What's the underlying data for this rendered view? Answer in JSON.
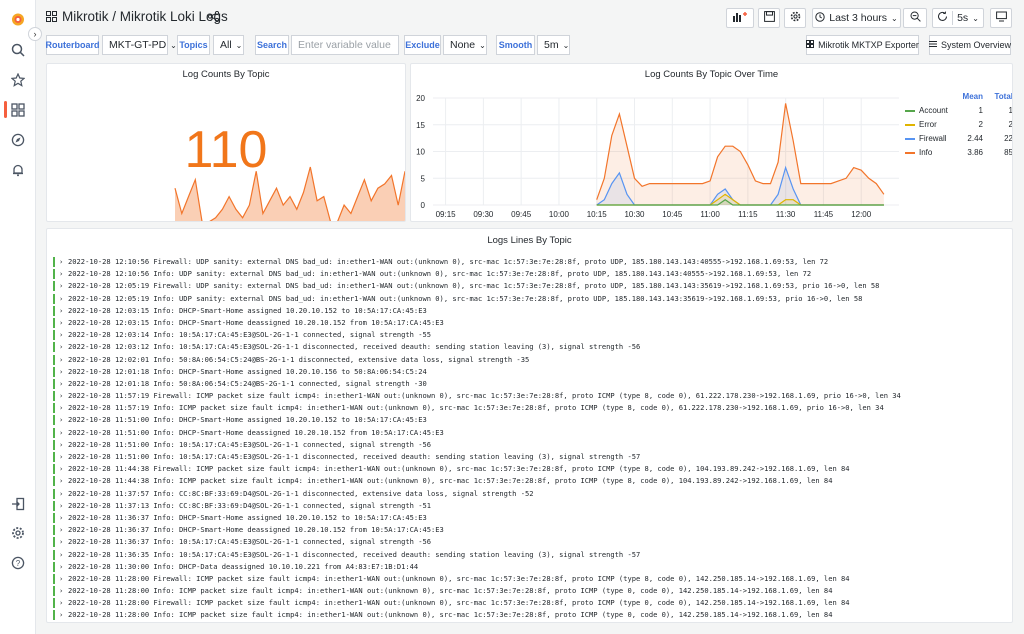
{
  "topbar": {
    "title": "Mikrotik / Mikrotik Loki Logs",
    "time_range": "Last 3 hours",
    "refresh": "5s"
  },
  "variables": {
    "routerboard_label": "Routerboard",
    "routerboard_value": "MKT-GT-PD",
    "topics_label": "Topics",
    "topics_value": "All",
    "search_label": "Search",
    "search_placeholder": "Enter variable value",
    "exclude_label": "Exclude",
    "exclude_value": "None",
    "smooth_label": "Smooth",
    "smooth_value": "5m",
    "link1": "Mikrotik MKTXP Exporter",
    "link2": "System Overview"
  },
  "panels": {
    "stat_title": "Log Counts By Topic",
    "stat_value": "110",
    "timeseries_title": "Log Counts By Topic Over Time",
    "logs_title": "Logs Lines By Topic"
  },
  "legend": {
    "mean_header": "Mean",
    "total_header": "Total",
    "items": [
      {
        "name": "Account",
        "mean": "1",
        "total": "1",
        "color": "#56a64b"
      },
      {
        "name": "Error",
        "mean": "2",
        "total": "2",
        "color": "#e0b400"
      },
      {
        "name": "Firewall",
        "mean": "2.44",
        "total": "22",
        "color": "#5794f2"
      },
      {
        "name": "Info",
        "mean": "3.86",
        "total": "85",
        "color": "#f2752b"
      }
    ]
  },
  "chart_data": {
    "type": "area",
    "x": [
      "09:15",
      "09:30",
      "09:45",
      "10:00",
      "10:15",
      "10:30",
      "10:45",
      "11:00",
      "11:15",
      "11:30",
      "11:45",
      "12:00"
    ],
    "ylim": [
      0,
      20
    ],
    "yticks": [
      "0",
      "5",
      "10",
      "15",
      "20"
    ],
    "grid": true,
    "legend_position": "top-right",
    "sample_times": [
      "10:15",
      "10:18",
      "10:21",
      "10:24",
      "10:27",
      "10:30",
      "10:33",
      "10:36",
      "10:39",
      "10:42",
      "10:45",
      "10:48",
      "10:51",
      "10:54",
      "10:57",
      "11:00",
      "11:03",
      "11:06",
      "11:09",
      "11:12",
      "11:15",
      "11:18",
      "11:21",
      "11:24",
      "11:27",
      "11:30",
      "11:33",
      "11:36",
      "11:39",
      "11:42",
      "11:45",
      "11:48",
      "11:51",
      "11:54",
      "11:57",
      "12:00",
      "12:03",
      "12:06",
      "12:09"
    ],
    "series": [
      {
        "name": "Info",
        "color": "#f2752b",
        "values": [
          1,
          5,
          13,
          17,
          11,
          5,
          3.5,
          4,
          4,
          4,
          4,
          4,
          4,
          4,
          4,
          4.5,
          9,
          11,
          11,
          10,
          7.5,
          4.5,
          4,
          4,
          8,
          19,
          12,
          4,
          4,
          4,
          4,
          4,
          4.5,
          5,
          7,
          6.5,
          5,
          4,
          2
        ]
      },
      {
        "name": "Firewall",
        "color": "#5794f2",
        "values": [
          0,
          1,
          4,
          6,
          2,
          0,
          0,
          0,
          0,
          0,
          0,
          0,
          0,
          0,
          0,
          0,
          2,
          3,
          1,
          0,
          0,
          0,
          0,
          0,
          2,
          7,
          3,
          0,
          0,
          0,
          0,
          0,
          0,
          0,
          0,
          0,
          0,
          0,
          0
        ]
      },
      {
        "name": "Error",
        "color": "#e0b400",
        "values": [
          0,
          0,
          0,
          0,
          0,
          0,
          0,
          0,
          0,
          0,
          0,
          0,
          0,
          0,
          0,
          0,
          1,
          2,
          1,
          0,
          0,
          0,
          0,
          0,
          0,
          1,
          1,
          0,
          0,
          0,
          0,
          0,
          0,
          0,
          0,
          0,
          0,
          0,
          0
        ]
      },
      {
        "name": "Account",
        "color": "#56a64b",
        "values": [
          0,
          0,
          0,
          0,
          0,
          0,
          0,
          0,
          0,
          0,
          0,
          0,
          0,
          0,
          0,
          0,
          0,
          1,
          0,
          0,
          0,
          0,
          0,
          0,
          0,
          0,
          0,
          0,
          0,
          0,
          0,
          0,
          0,
          0,
          0,
          0,
          0,
          0,
          0
        ]
      }
    ]
  },
  "sparkline": {
    "color": "#f2752b",
    "values": [
      8,
      2,
      6,
      10,
      0,
      0,
      1,
      3,
      6,
      3,
      1,
      4,
      12,
      2,
      5,
      8,
      4,
      6,
      3,
      7,
      13,
      5,
      6,
      0,
      0,
      4,
      2,
      6,
      10,
      5,
      8,
      9,
      11,
      4,
      12
    ]
  },
  "logs": [
    "2022-10-28 12:10:56 Firewall: UDP sanity: external DNS bad_ud: in:ether1-WAN out:(unknown 0), src-mac 1c:57:3e:7e:28:8f, proto UDP, 185.180.143.143:40555->192.168.1.69:53, len 72",
    "2022-10-28 12:10:56 Info: UDP sanity: external DNS bad_ud: in:ether1-WAN out:(unknown 0), src-mac 1c:57:3e:7e:28:8f, proto UDP, 185.180.143.143:40555->192.168.1.69:53, len 72",
    "2022-10-28 12:05:19 Firewall: UDP sanity: external DNS bad_ud: in:ether1-WAN out:(unknown 0), src-mac 1c:57:3e:7e:28:8f, proto UDP, 185.180.143.143:35619->192.168.1.69:53, prio 16->0, len 58",
    "2022-10-28 12:05:19 Info: UDP sanity: external DNS bad_ud: in:ether1-WAN out:(unknown 0), src-mac 1c:57:3e:7e:28:8f, proto UDP, 185.180.143.143:35619->192.168.1.69:53, prio 16->0, len 58",
    "2022-10-28 12:03:15 Info: DHCP-Smart-Home assigned 10.20.10.152 to 10:5A:17:CA:45:E3",
    "2022-10-28 12:03:15 Info: DHCP-Smart-Home deassigned 10.20.10.152 from 10:5A:17:CA:45:E3",
    "2022-10-28 12:03:14 Info: 10:5A:17:CA:45:E3@SOL-2G-1-1 connected, signal strength -55",
    "2022-10-28 12:03:12 Info: 10:5A:17:CA:45:E3@SOL-2G-1-1 disconnected, received deauth: sending station leaving (3), signal strength -56",
    "2022-10-28 12:02:01 Info: 50:8A:06:54:C5:24@BS-2G-1-1 disconnected, extensive data loss, signal strength -35",
    "2022-10-28 12:01:18 Info: DHCP-Smart-Home assigned 10.20.10.156 to 50:8A:06:54:C5:24",
    "2022-10-28 12:01:18 Info: 50:8A:06:54:C5:24@BS-2G-1-1 connected, signal strength -30",
    "2022-10-28 11:57:19 Firewall: ICMP packet size fault icmp4: in:ether1-WAN out:(unknown 0), src-mac 1c:57:3e:7e:28:8f, proto ICMP (type 8, code 0), 61.222.178.230->192.168.1.69, prio 16->0, len 34",
    "2022-10-28 11:57:19 Info: ICMP packet size fault icmp4: in:ether1-WAN out:(unknown 0), src-mac 1c:57:3e:7e:28:8f, proto ICMP (type 8, code 0), 61.222.178.230->192.168.1.69, prio 16->0, len 34",
    "2022-10-28 11:51:00 Info: DHCP-Smart-Home assigned 10.20.10.152 to 10:5A:17:CA:45:E3",
    "2022-10-28 11:51:00 Info: DHCP-Smart-Home deassigned 10.20.10.152 from 10:5A:17:CA:45:E3",
    "2022-10-28 11:51:00 Info: 10:5A:17:CA:45:E3@SOL-2G-1-1 connected, signal strength -56",
    "2022-10-28 11:51:00 Info: 10:5A:17:CA:45:E3@SOL-2G-1-1 disconnected, received deauth: sending station leaving (3), signal strength -57",
    "2022-10-28 11:44:38 Firewall: ICMP packet size fault icmp4: in:ether1-WAN out:(unknown 0), src-mac 1c:57:3e:7e:28:8f, proto ICMP (type 8, code 0), 104.193.89.242->192.168.1.69, len 84",
    "2022-10-28 11:44:38 Info: ICMP packet size fault icmp4: in:ether1-WAN out:(unknown 0), src-mac 1c:57:3e:7e:28:8f, proto ICMP (type 8, code 0), 104.193.89.242->192.168.1.69, len 84",
    "2022-10-28 11:37:57 Info: CC:8C:BF:33:69:D4@SOL-2G-1-1 disconnected, extensive data loss, signal strength -52",
    "2022-10-28 11:37:13 Info: CC:8C:BF:33:69:D4@SOL-2G-1-1 connected, signal strength -51",
    "2022-10-28 11:36:37 Info: DHCP-Smart-Home assigned 10.20.10.152 to 10:5A:17:CA:45:E3",
    "2022-10-28 11:36:37 Info: DHCP-Smart-Home deassigned 10.20.10.152 from 10:5A:17:CA:45:E3",
    "2022-10-28 11:36:37 Info: 10:5A:17:CA:45:E3@SOL-2G-1-1 connected, signal strength -56",
    "2022-10-28 11:36:35 Info: 10:5A:17:CA:45:E3@SOL-2G-1-1 disconnected, received deauth: sending station leaving (3), signal strength -57",
    "2022-10-28 11:30:00 Info: DHCP-Data deassigned 10.10.10.221 from A4:83:E7:1B:D1:44",
    "2022-10-28 11:28:00 Firewall: ICMP packet size fault icmp4: in:ether1-WAN out:(unknown 0), src-mac 1c:57:3e:7e:28:8f, proto ICMP (type 8, code 0), 142.250.185.14->192.168.1.69, len 84",
    "2022-10-28 11:28:00 Info: ICMP packet size fault icmp4: in:ether1-WAN out:(unknown 0), src-mac 1c:57:3e:7e:28:8f, proto ICMP (type 0, code 0), 142.250.185.14->192.168.1.69, len 84",
    "2022-10-28 11:28:00 Firewall: ICMP packet size fault icmp4: in:ether1-WAN out:(unknown 0), src-mac 1c:57:3e:7e:28:8f, proto ICMP (type 0, code 0), 142.250.185.14->192.168.1.69, len 84",
    "2022-10-28 11:28:00 Info: ICMP packet size fault icmp4: in:ether1-WAN out:(unknown 0), src-mac 1c:57:3e:7e:28:8f, proto ICMP (type 0, code 0), 142.250.185.14->192.168.1.69, len 84"
  ]
}
